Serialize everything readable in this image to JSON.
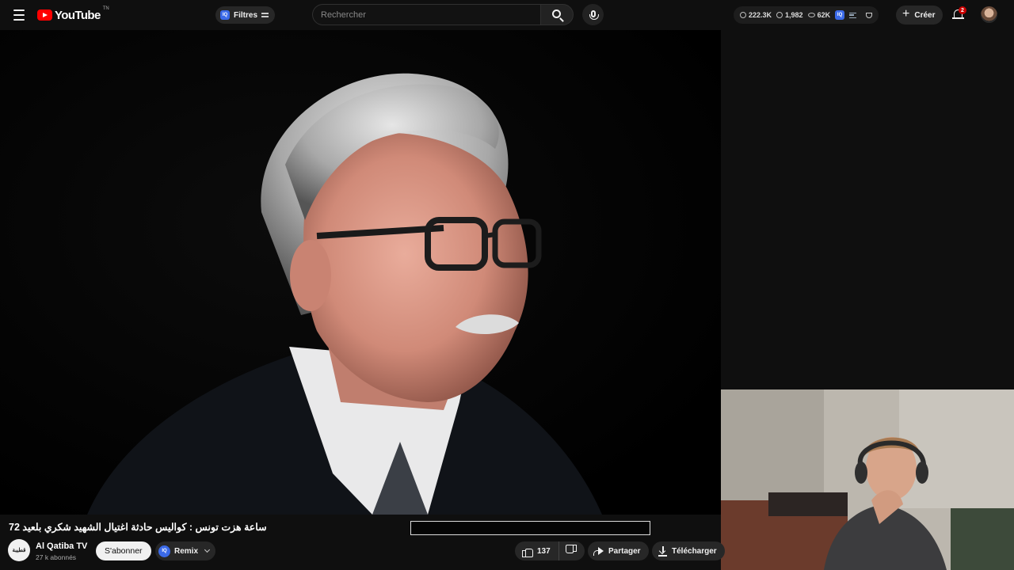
{
  "header": {
    "logo_text": "YouTube",
    "logo_tm": "TN",
    "filters_label": "Filtres",
    "filters_badge": "IQ",
    "search_placeholder": "Rechercher",
    "stats": {
      "watch_time": "222.3K",
      "videos": "1,982",
      "views": "62K"
    },
    "stats_badge": "IQ",
    "create_label": "Créer",
    "notifications_count": "2"
  },
  "video": {
    "title": "ساعة هزت تونس : كواليس حادثة اغتيال الشهيد شكري بلعيد 72"
  },
  "channel": {
    "name": "Al Qatiba TV",
    "subscribers": "27 k abonnés",
    "avatar_text": "قطيبة"
  },
  "actions": {
    "subscribe_label": "S'abonner",
    "remix_label": "Remix",
    "remix_badge": "IQ",
    "likes": "137",
    "share_label": "Partager",
    "download_label": "Télécharger"
  },
  "colors": {
    "accent": "#ff0000",
    "badge_blue": "#3b6ae8",
    "background": "#0f0f0f"
  }
}
